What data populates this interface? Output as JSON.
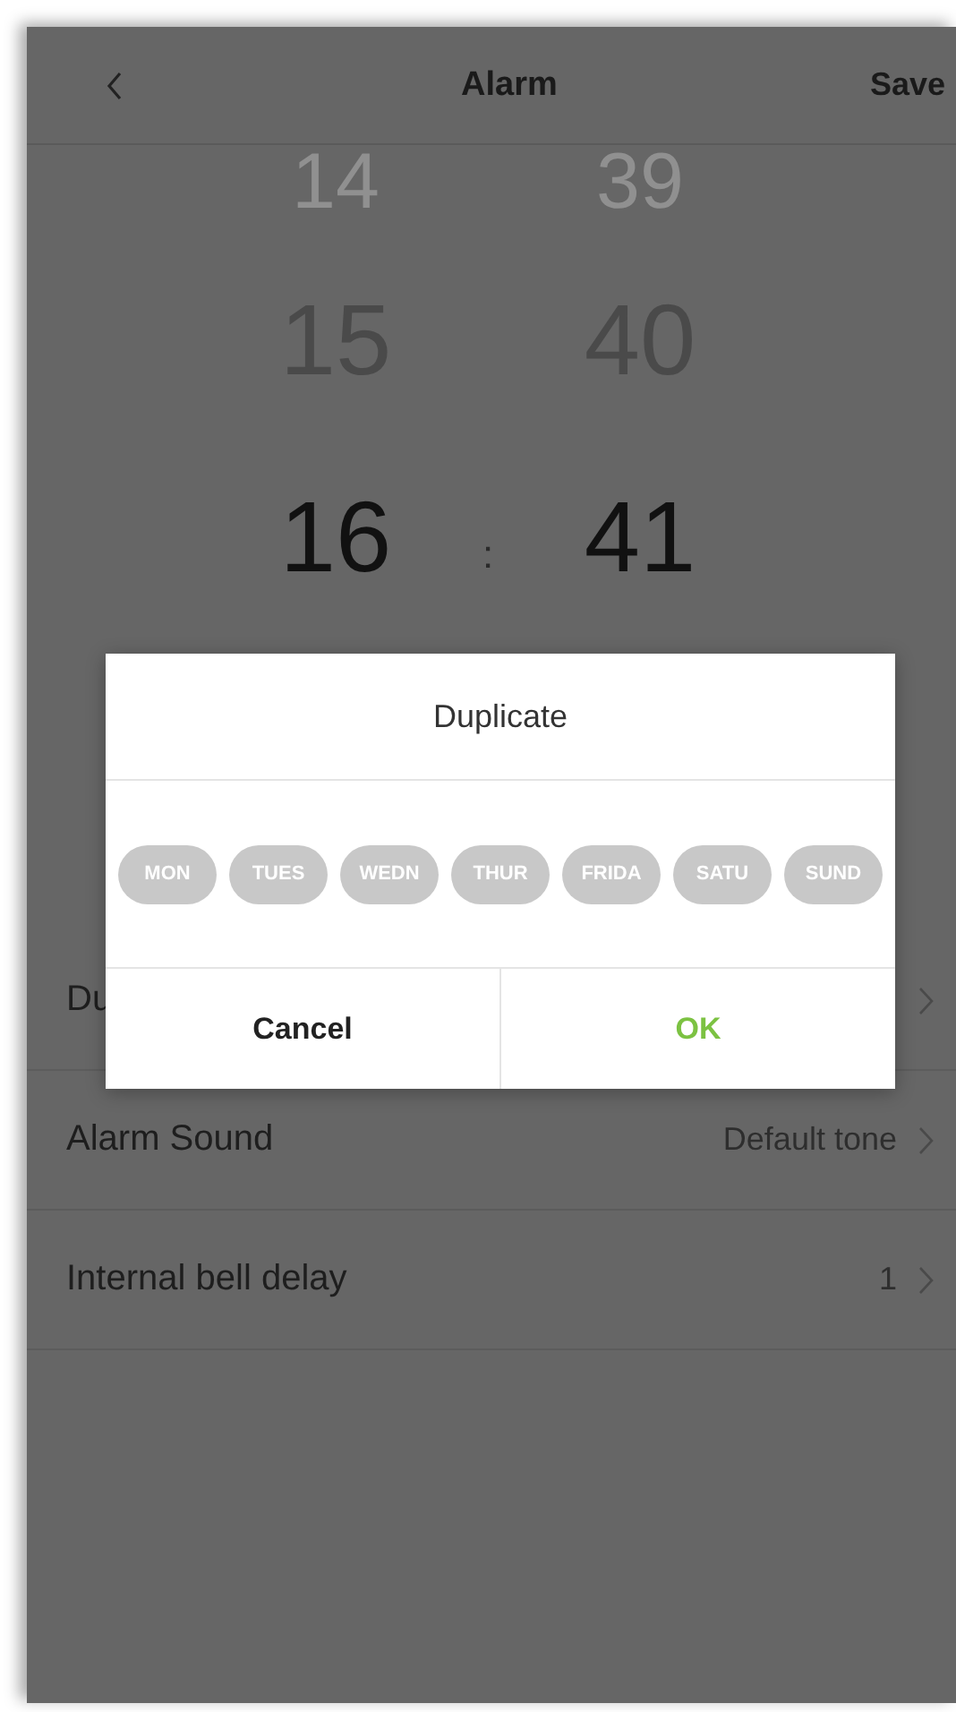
{
  "header": {
    "title": "Alarm",
    "save": "Save"
  },
  "picker": {
    "hours": [
      {
        "value": "14",
        "selected": false
      },
      {
        "value": "15",
        "selected": false
      },
      {
        "value": "16",
        "selected": true
      }
    ],
    "minutes": [
      {
        "value": "39",
        "selected": false
      },
      {
        "value": "40",
        "selected": false
      },
      {
        "value": "41",
        "selected": true
      }
    ],
    "separator": ":"
  },
  "settings": [
    {
      "label": "Du"
    },
    {
      "label": "Alarm Sound",
      "value": "Default tone"
    },
    {
      "label": "Internal bell delay",
      "value": "1"
    }
  ],
  "dialog": {
    "title": "Duplicate",
    "days": [
      {
        "label": "MON",
        "selected": false
      },
      {
        "label": "TUES",
        "selected": false
      },
      {
        "label": "WEDN",
        "selected": false
      },
      {
        "label": "THUR",
        "selected": false
      },
      {
        "label": "FRIDA",
        "selected": false
      },
      {
        "label": "SATU",
        "selected": false
      },
      {
        "label": "SUND",
        "selected": false
      }
    ],
    "cancel": "Cancel",
    "ok": "OK"
  }
}
